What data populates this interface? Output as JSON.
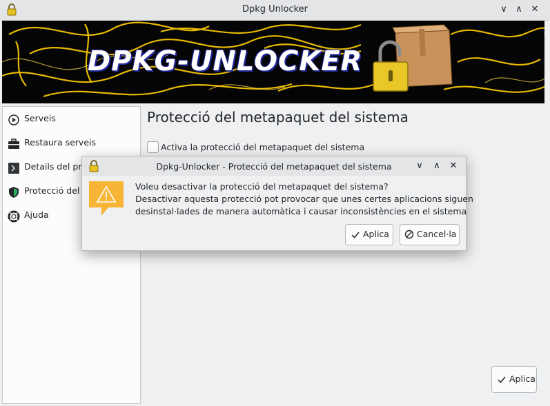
{
  "window": {
    "title": "Dpkg Unlocker",
    "minimize_glyph": "∨",
    "maximize_glyph": "∧",
    "close_glyph": "✕"
  },
  "banner": {
    "logo_text": "DPKG-UNLOCKER"
  },
  "sidebar": {
    "items": [
      {
        "label": "Serveis",
        "icon": "services-icon"
      },
      {
        "label": "Restaura serveis",
        "icon": "toolbox-icon"
      },
      {
        "label": "Details del pro",
        "icon": "terminal-icon"
      },
      {
        "label": "Protecció del m",
        "icon": "shield-icon"
      },
      {
        "label": "Ajuda",
        "icon": "help-lifebuoy-icon"
      }
    ]
  },
  "main": {
    "title": "Protecció del metapaquet del sistema",
    "checkbox_label": "Activa la protecció del metapaquet del sistema",
    "checkbox_checked": false,
    "apply_label": "Aplica"
  },
  "dialog": {
    "title": "Dpkg-Unlocker - Protecció del metapaquet del sistema",
    "line1": "Voleu desactivar la protecció del metapaquet del sistema?",
    "line2": "Desactivar aquesta protecció pot provocar que unes certes aplicacions siguen",
    "line3": "desinstal·lades de manera automàtica i causar inconsistències en el sistema",
    "apply_label": "Aplica",
    "cancel_label": "Cancel·la",
    "warning_color": "#f7b538"
  },
  "colors": {
    "background": "#eff0f1",
    "banner_flame": "#f5c400",
    "checkmark": "#232629"
  }
}
